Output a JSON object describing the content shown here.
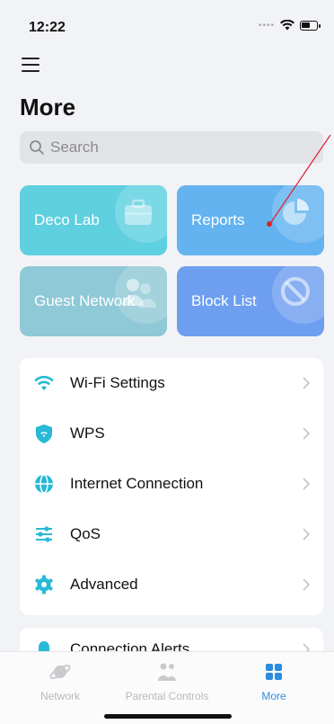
{
  "status_bar": {
    "time": "12:22"
  },
  "page": {
    "title": "More"
  },
  "search": {
    "placeholder": "Search"
  },
  "tiles": [
    {
      "label": "Deco Lab",
      "icon": "toolbox-icon"
    },
    {
      "label": "Reports",
      "icon": "pie-chart-icon"
    },
    {
      "label": "Guest Network",
      "icon": "users-icon"
    },
    {
      "label": "Block List",
      "icon": "block-icon"
    }
  ],
  "settings": [
    {
      "label": "Wi-Fi Settings",
      "icon": "wifi-icon"
    },
    {
      "label": "WPS",
      "icon": "wps-shield-icon"
    },
    {
      "label": "Internet Connection",
      "icon": "globe-icon"
    },
    {
      "label": "QoS",
      "icon": "sliders-icon"
    },
    {
      "label": "Advanced",
      "icon": "gear-icon"
    }
  ],
  "alerts": {
    "label": "Connection Alerts",
    "icon": "bell-icon"
  },
  "tab_bar": {
    "tabs": [
      {
        "label": "Network",
        "icon": "planet-icon",
        "active": false
      },
      {
        "label": "Parental Controls",
        "icon": "family-icon",
        "active": false
      },
      {
        "label": "More",
        "icon": "grid-icon",
        "active": true
      }
    ]
  },
  "colors": {
    "accent": "#2a8de0",
    "icon_teal": "#27b9d6",
    "tile_decolab": "#5fd0e0",
    "tile_reports": "#62b3f0",
    "tile_guest": "#8fc8d6",
    "tile_block": "#6e9ef0",
    "annotation": "#e0202a"
  }
}
